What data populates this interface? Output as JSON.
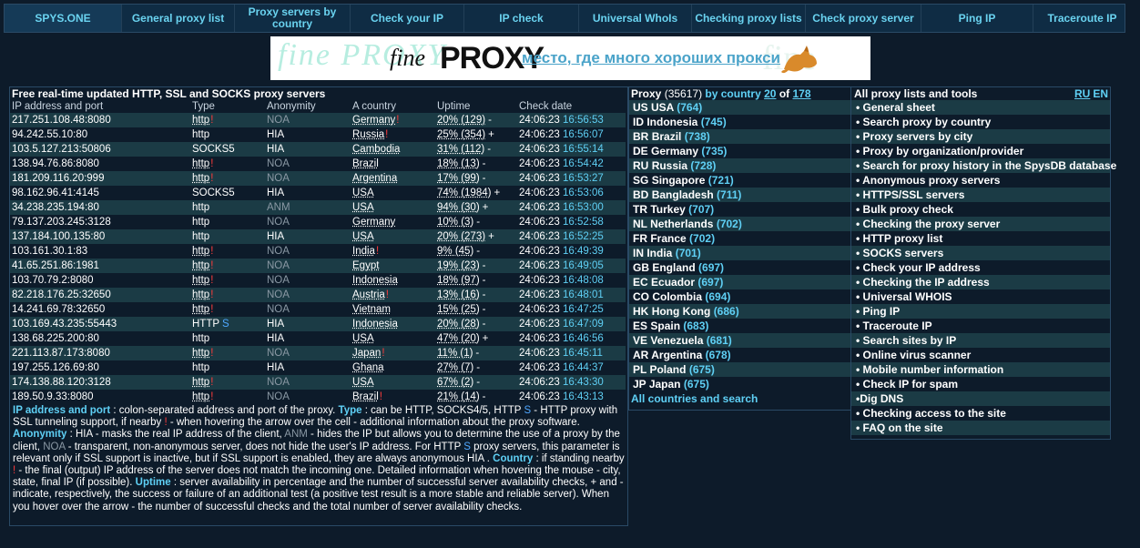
{
  "nav": [
    "SPYS.ONE",
    "General proxy list",
    "Proxy servers by country",
    "Check your IP",
    "IP check",
    "Universal WhoIs",
    "Checking proxy lists",
    "Check proxy server",
    "Ping IP",
    "Traceroute IP"
  ],
  "banner": {
    "ghost_left": "fine PROXY",
    "ghost_right": "fine",
    "brand_fine": "fine",
    "brand_proxy": "PROXY",
    "tagline": "место, где много хороших прокси"
  },
  "proxy_panel": {
    "title": "Free real-time updated HTTP, SSL and SOCKS proxy servers",
    "headers": [
      "IP address and port",
      "Type",
      "Anonymity",
      "A country",
      "Uptime",
      "Check date"
    ],
    "rows": [
      {
        "ip": "217.251.108.48:8080",
        "type": "http",
        "type_flag": "!",
        "anon": "NOA",
        "country": "Germany",
        "c_flag": "!",
        "uptime": "20% (129)",
        "u_flag": "-",
        "date": "24:06:23",
        "time": "16:56:53"
      },
      {
        "ip": "94.242.55.10:80",
        "type": "http",
        "type_flag": "",
        "anon": "HIA",
        "country": "Russia",
        "c_flag": "!",
        "uptime": "25% (354)",
        "u_flag": "+",
        "date": "24:06:23",
        "time": "16:56:07"
      },
      {
        "ip": "103.5.127.213:50806",
        "type": "SOCKS5",
        "type_flag": "",
        "anon": "HIA",
        "country": "Cambodia",
        "c_flag": "",
        "uptime": "31% (112)",
        "u_flag": "-",
        "date": "24:06:23",
        "time": "16:55:14"
      },
      {
        "ip": "138.94.76.86:8080",
        "type": "http",
        "type_flag": "!",
        "anon": "NOA",
        "country": "Brazil",
        "c_flag": "",
        "uptime": "18% (13)",
        "u_flag": "-",
        "date": "24:06:23",
        "time": "16:54:42"
      },
      {
        "ip": "181.209.116.20:999",
        "type": "http",
        "type_flag": "!",
        "anon": "NOA",
        "country": "Argentina",
        "c_flag": "",
        "uptime": "17% (99)",
        "u_flag": "-",
        "date": "24:06:23",
        "time": "16:53:27"
      },
      {
        "ip": "98.162.96.41:4145",
        "type": "SOCKS5",
        "type_flag": "",
        "anon": "HIA",
        "country": "USA",
        "c_flag": "",
        "uptime": "74% (1984)",
        "u_flag": "+",
        "date": "24:06:23",
        "time": "16:53:06"
      },
      {
        "ip": "34.238.235.194:80",
        "type": "http",
        "type_flag": "",
        "anon": "ANM",
        "country": "USA",
        "c_flag": "",
        "uptime": "94% (30)",
        "u_flag": "+",
        "date": "24:06:23",
        "time": "16:53:00"
      },
      {
        "ip": "79.137.203.245:3128",
        "type": "http",
        "type_flag": "",
        "anon": "NOA",
        "country": "Germany",
        "c_flag": "",
        "uptime": "10% (3)",
        "u_flag": "-",
        "date": "24:06:23",
        "time": "16:52:58"
      },
      {
        "ip": "137.184.100.135:80",
        "type": "http",
        "type_flag": "",
        "anon": "HIA",
        "country": "USA",
        "c_flag": "",
        "uptime": "20% (273)",
        "u_flag": "+",
        "date": "24:06:23",
        "time": "16:52:25"
      },
      {
        "ip": "103.161.30.1:83",
        "type": "http",
        "type_flag": "!",
        "anon": "NOA",
        "country": "India",
        "c_flag": "!",
        "uptime": "9% (45)",
        "u_flag": "-",
        "date": "24:06:23",
        "time": "16:49:39"
      },
      {
        "ip": "41.65.251.86:1981",
        "type": "http",
        "type_flag": "!",
        "anon": "NOA",
        "country": "Egypt",
        "c_flag": "",
        "uptime": "19% (23)",
        "u_flag": "-",
        "date": "24:06:23",
        "time": "16:49:05"
      },
      {
        "ip": "103.70.79.2:8080",
        "type": "http",
        "type_flag": "!",
        "anon": "NOA",
        "country": "Indonesia",
        "c_flag": "",
        "uptime": "18% (97)",
        "u_flag": "-",
        "date": "24:06:23",
        "time": "16:48:08"
      },
      {
        "ip": "82.218.176.25:32650",
        "type": "http",
        "type_flag": "!",
        "anon": "NOA",
        "country": "Austria",
        "c_flag": "!",
        "uptime": "13% (16)",
        "u_flag": "-",
        "date": "24:06:23",
        "time": "16:48:01"
      },
      {
        "ip": "14.241.69.78:32650",
        "type": "http",
        "type_flag": "!",
        "anon": "NOA",
        "country": "Vietnam",
        "c_flag": "",
        "uptime": "15% (25)",
        "u_flag": "-",
        "date": "24:06:23",
        "time": "16:47:25"
      },
      {
        "ip": "103.169.43.235:55443",
        "type": "HTTP",
        "type_flag": "S",
        "anon": "HIA",
        "country": "Indonesia",
        "c_flag": "",
        "uptime": "20% (28)",
        "u_flag": "-",
        "date": "24:06:23",
        "time": "16:47:09"
      },
      {
        "ip": "138.68.225.200:80",
        "type": "http",
        "type_flag": "",
        "anon": "HIA",
        "country": "USA",
        "c_flag": "",
        "uptime": "47% (20)",
        "u_flag": "+",
        "date": "24:06:23",
        "time": "16:46:56"
      },
      {
        "ip": "221.113.87.173:8080",
        "type": "http",
        "type_flag": "!",
        "anon": "NOA",
        "country": "Japan",
        "c_flag": "!",
        "uptime": "11% (1)",
        "u_flag": "-",
        "date": "24:06:23",
        "time": "16:45:11"
      },
      {
        "ip": "197.255.126.69:80",
        "type": "http",
        "type_flag": "",
        "anon": "HIA",
        "country": "Ghana",
        "c_flag": "",
        "uptime": "27% (7)",
        "u_flag": "-",
        "date": "24:06:23",
        "time": "16:44:37"
      },
      {
        "ip": "174.138.88.120:3128",
        "type": "http",
        "type_flag": "!",
        "anon": "NOA",
        "country": "USA",
        "c_flag": "",
        "uptime": "67% (2)",
        "u_flag": "-",
        "date": "24:06:23",
        "time": "16:43:30"
      },
      {
        "ip": "189.50.9.33:8080",
        "type": "http",
        "type_flag": "!",
        "anon": "NOA",
        "country": "Brazil",
        "c_flag": "!",
        "uptime": "21% (14)",
        "u_flag": "-",
        "date": "24:06:23",
        "time": "16:43:13"
      }
    ]
  },
  "description": {
    "h_ip": "IP address and port",
    "t_ip": " : colon-separated address and port of the proxy. ",
    "h_type": "Type",
    "t_type1": " : can be HTTP, SOCKS4/5, HTTP ",
    "s_letter": "S",
    "t_type2": " - HTTP proxy with SSL tunneling support, if nearby ",
    "bang": "!",
    "t_type3": " - when hovering the arrow over the cell - additional information about the proxy software. ",
    "h_anon": "Anonymity",
    "t_anon1": " : HIA - masks the real IP address of the client, ",
    "anm": "ANM",
    "t_anon2": " - hides the IP but allows you to determine the use of a proxy by the client, ",
    "noa": "NOA",
    "t_anon3": " - transparent, non-anonymous server, does not hide the user's IP address. For HTTP ",
    "s_letter2": "S",
    "t_anon4": " proxy servers, this parameter is relevant only if SSL support is inactive, but if SSL support is enabled, they are always anonymous HIA . ",
    "h_country": "Country",
    "t_country1": " : if standing nearby ",
    "bang2": "!",
    "t_country2": " - the final (output) IP address of the server does not match the incoming one. Detailed information when hovering the mouse - city, state, final IP (if possible). ",
    "h_uptime": "Uptime",
    "t_uptime": " : server availability in percentage and the number of successful server availability checks, + and - indicate, respectively, the success or failure of an additional test (a positive test result is a more stable and reliable server). When you hover over the arrow - the number of successful checks and the total number of server availability checks."
  },
  "country_panel": {
    "title_prefix": "Proxy",
    "total": "(35617)",
    "by": "by country",
    "shown": "20",
    "of": "of",
    "pages": "178",
    "items": [
      {
        "code": "US",
        "name": "USA",
        "count": "(764)"
      },
      {
        "code": "ID",
        "name": "Indonesia",
        "count": "(745)"
      },
      {
        "code": "BR",
        "name": "Brazil",
        "count": "(738)"
      },
      {
        "code": "DE",
        "name": "Germany",
        "count": "(735)"
      },
      {
        "code": "RU",
        "name": "Russia",
        "count": "(728)"
      },
      {
        "code": "SG",
        "name": "Singapore",
        "count": "(721)"
      },
      {
        "code": "BD",
        "name": "Bangladesh",
        "count": "(711)"
      },
      {
        "code": "TR",
        "name": "Turkey",
        "count": "(707)"
      },
      {
        "code": "NL",
        "name": "Netherlands",
        "count": "(702)"
      },
      {
        "code": "FR",
        "name": "France",
        "count": "(702)"
      },
      {
        "code": "IN",
        "name": "India",
        "count": "(701)"
      },
      {
        "code": "GB",
        "name": "England",
        "count": "(697)"
      },
      {
        "code": "EC",
        "name": "Ecuador",
        "count": "(697)"
      },
      {
        "code": "CO",
        "name": "Colombia",
        "count": "(694)"
      },
      {
        "code": "HK",
        "name": "Hong Kong",
        "count": "(686)"
      },
      {
        "code": "ES",
        "name": "Spain",
        "count": "(683)"
      },
      {
        "code": "VE",
        "name": "Venezuela",
        "count": "(681)"
      },
      {
        "code": "AR",
        "name": "Argentina",
        "count": "(678)"
      },
      {
        "code": "PL",
        "name": "Poland",
        "count": "(675)"
      },
      {
        "code": "JP",
        "name": "Japan",
        "count": "(675)"
      }
    ],
    "footer": "All countries and search"
  },
  "tools_panel": {
    "title": "All proxy lists and tools",
    "lang_ru": "RU",
    "lang_en": "EN",
    "items": [
      "• General sheet",
      "• Search proxy by country",
      "• Proxy servers by city",
      "• Proxy by organization/provider",
      "• Search for proxy history in the SpysDB database",
      "• Anonymous proxy servers",
      "• HTTPS/SSL servers",
      "• Bulk proxy check",
      "• Checking the proxy server",
      "• HTTP proxy list",
      "• SOCKS servers",
      "• Check your IP address",
      "• Checking the IP address",
      "• Universal WHOIS",
      "• Ping IP",
      "• Traceroute IP",
      "• Search sites by IP",
      "• Online virus scanner",
      "• Mobile number information",
      "• Check IP for spam",
      "•Dig DNS",
      "• Checking access to the site",
      "• FAQ on the site"
    ]
  }
}
